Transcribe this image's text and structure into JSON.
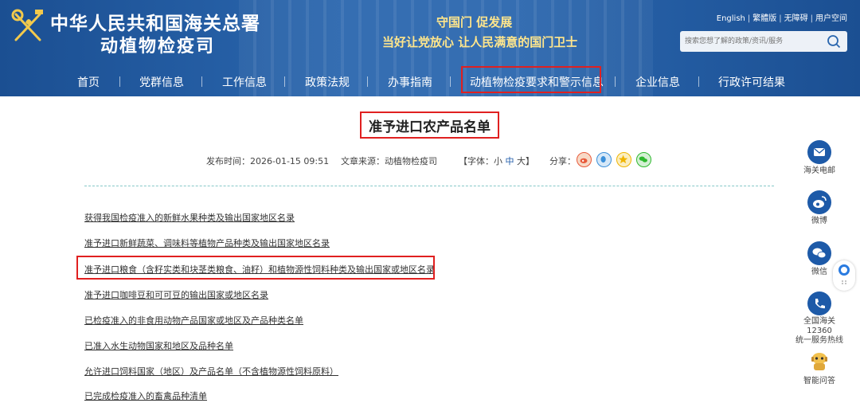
{
  "header": {
    "org_line1": "中华人民共和国海关总署",
    "org_line2": "动植物检疫司",
    "slogan_line1": "守国门  促发展",
    "slogan_line2": "当好让党放心  让人民满意的国门卫士",
    "top_links": [
      "English",
      "繁體版",
      "无障碍",
      "用户空间"
    ],
    "search_placeholder": "搜索您想了解的政策/资讯/服务"
  },
  "nav": {
    "items": [
      "首页",
      "党群信息",
      "工作信息",
      "政策法规",
      "办事指南",
      "动植物检疫要求和警示信息",
      "企业信息",
      "行政许可结果"
    ],
    "highlighted": "动植物检疫要求和警示信息"
  },
  "article": {
    "title": "准予进口农产品名单",
    "publish_time": "发布时间：2026-01-15 09:51",
    "source": "文章来源：动植物检疫司",
    "font_label": "【字体：",
    "font_small": "小",
    "font_medium": "中",
    "font_large": "大",
    "font_close": "】",
    "share_label": "分享：",
    "links": [
      "获得我国检疫准入的新鲜水果种类及输出国家地区名录",
      "准予进口新鲜蔬菜、调味料等植物产品种类及输出国家地区名录",
      "准予进口粮食（含籽实类和块茎类粮食、油籽）和植物源性饲料种类及输出国家或地区名录",
      "准予进口咖啡豆和可可豆的输出国家或地区名录",
      "已检疫准入的非食用动物产品国家或地区及产品种类名单",
      "已准入水生动物国家和地区及品种名单",
      "允许进口饲料国家（地区）及产品名单（不含植物源性饲料原料）",
      "已完成检疫准入的畜禽品种清单"
    ]
  },
  "sidebar": {
    "mail": "海关电邮",
    "weibo": "微博",
    "wechat": "微信",
    "hotline_line1": "全国海关12360",
    "hotline_line2": "统一服务热线",
    "qa": "智能问答"
  },
  "colors": {
    "header_blue": "#2a66ae",
    "slogan_yellow": "#ffe68c",
    "highlight_red": "#e02020",
    "side_blue": "#1d5aa8"
  }
}
